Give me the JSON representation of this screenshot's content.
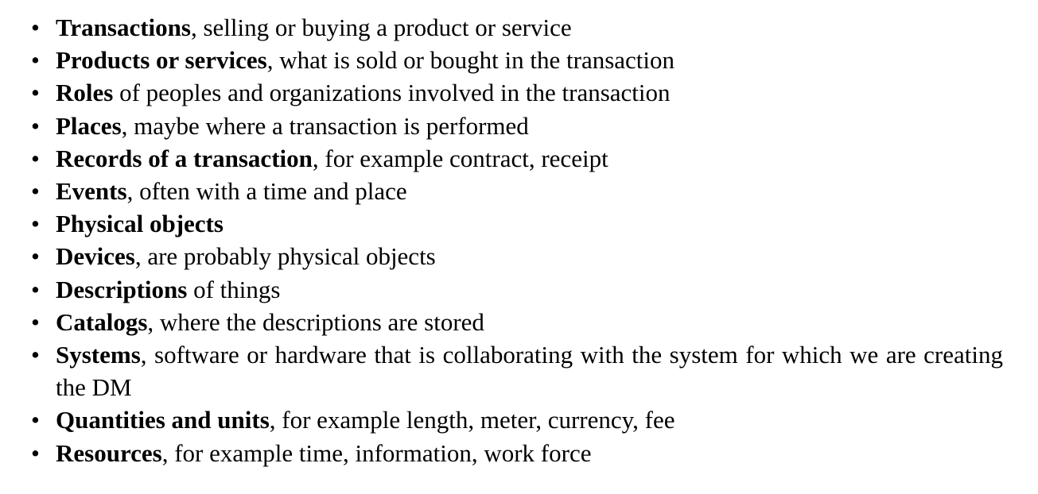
{
  "items": [
    {
      "term": "Transactions",
      "rest": ", selling or buying a product or service"
    },
    {
      "term": "Products or services",
      "rest": ", what is sold or bought in the transaction"
    },
    {
      "term": "Roles",
      "rest": " of peoples and organizations involved in the transaction"
    },
    {
      "term": "Places",
      "rest": ", maybe where a transaction is performed"
    },
    {
      "term": "Records of a transaction",
      "rest": ", for example contract, receipt"
    },
    {
      "term": "Events",
      "rest": ", often with a time and place"
    },
    {
      "term": "Physical objects",
      "rest": ""
    },
    {
      "term": "Devices",
      "rest": ", are probably physical objects"
    },
    {
      "term": "Descriptions",
      "rest": " of things"
    },
    {
      "term": "Catalogs",
      "rest": ", where the descriptions are stored"
    },
    {
      "term": "Systems",
      "rest": ", software or hardware that is collaborating with the system for which we are creating the DM"
    },
    {
      "term": "Quantities and units",
      "rest": ", for example length, meter, currency, fee"
    },
    {
      "term": "Resources",
      "rest": ", for example time, information, work force"
    }
  ]
}
